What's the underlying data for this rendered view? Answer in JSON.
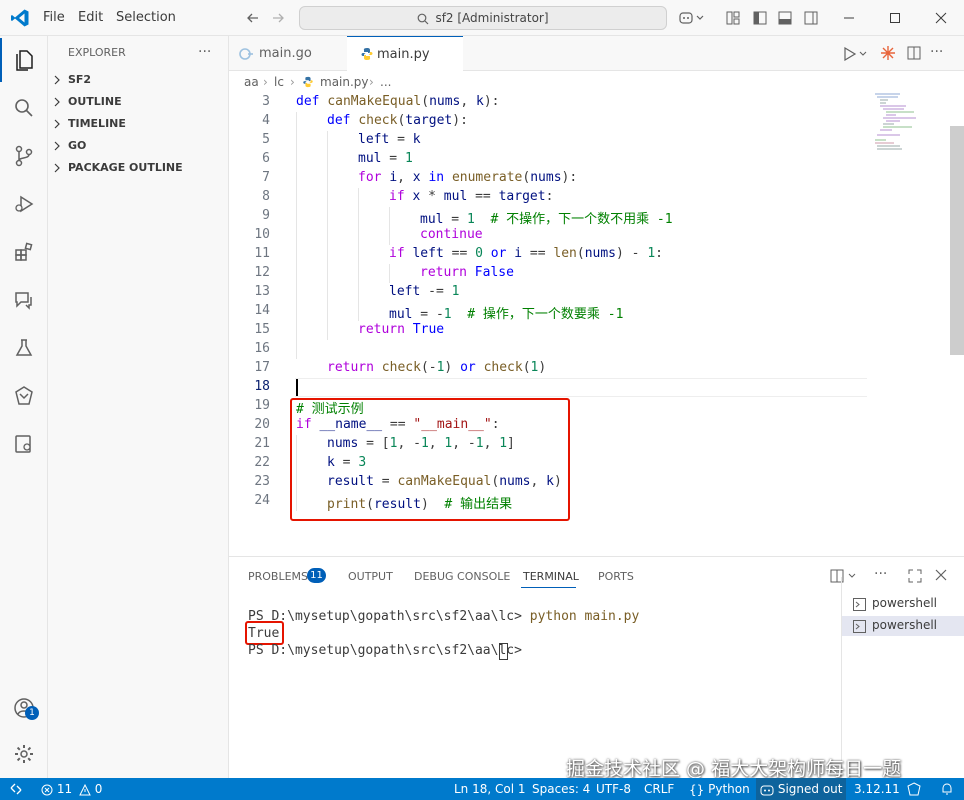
{
  "titlebar": {
    "menu": [
      "File",
      "Edit",
      "Selection"
    ],
    "search_text": "sf2 [Administrator]"
  },
  "sidebar": {
    "title": "EXPLORER",
    "sections": [
      "SF2",
      "OUTLINE",
      "TIMELINE",
      "GO",
      "PACKAGE OUTLINE"
    ]
  },
  "tabs": [
    {
      "label": "main.go",
      "active": false
    },
    {
      "label": "main.py",
      "active": true
    }
  ],
  "breadcrumb": [
    "aa",
    "lc",
    "main.py",
    "..."
  ],
  "editor": {
    "current_line": 18,
    "lines": [
      {
        "n": "3",
        "indent": 0,
        "tokens": [
          {
            "t": "def ",
            "c": "kw"
          },
          {
            "t": "canMakeEqual",
            "c": "fn"
          },
          {
            "t": "("
          },
          {
            "t": "nums",
            "c": "var"
          },
          {
            "t": ", "
          },
          {
            "t": "k",
            "c": "var"
          },
          {
            "t": "):"
          }
        ]
      },
      {
        "n": "4",
        "indent": 1,
        "tokens": [
          {
            "t": "def ",
            "c": "kw"
          },
          {
            "t": "check",
            "c": "fn"
          },
          {
            "t": "("
          },
          {
            "t": "target",
            "c": "var"
          },
          {
            "t": "):"
          }
        ]
      },
      {
        "n": "5",
        "indent": 2,
        "tokens": [
          {
            "t": "left",
            "c": "var"
          },
          {
            "t": " = "
          },
          {
            "t": "k",
            "c": "var"
          }
        ]
      },
      {
        "n": "6",
        "indent": 2,
        "tokens": [
          {
            "t": "mul",
            "c": "var"
          },
          {
            "t": " = "
          },
          {
            "t": "1",
            "c": "num"
          }
        ]
      },
      {
        "n": "7",
        "indent": 2,
        "tokens": [
          {
            "t": "for ",
            "c": "kwc"
          },
          {
            "t": "i",
            "c": "var"
          },
          {
            "t": ", "
          },
          {
            "t": "x",
            "c": "var"
          },
          {
            "t": " in ",
            "c": "kw"
          },
          {
            "t": "enumerate",
            "c": "fn"
          },
          {
            "t": "("
          },
          {
            "t": "nums",
            "c": "var"
          },
          {
            "t": "):"
          }
        ]
      },
      {
        "n": "8",
        "indent": 3,
        "tokens": [
          {
            "t": "if ",
            "c": "kwc"
          },
          {
            "t": "x",
            "c": "var"
          },
          {
            "t": " * "
          },
          {
            "t": "mul",
            "c": "var"
          },
          {
            "t": " == "
          },
          {
            "t": "target",
            "c": "var"
          },
          {
            "t": ":"
          }
        ]
      },
      {
        "n": "9",
        "indent": 4,
        "tokens": [
          {
            "t": "mul",
            "c": "var"
          },
          {
            "t": " = "
          },
          {
            "t": "1",
            "c": "num"
          },
          {
            "t": "  "
          },
          {
            "t": "# 不操作，下一个数不用乘 -1",
            "c": "cmt"
          }
        ]
      },
      {
        "n": "10",
        "indent": 4,
        "tokens": [
          {
            "t": "continue",
            "c": "kwc"
          }
        ]
      },
      {
        "n": "11",
        "indent": 3,
        "tokens": [
          {
            "t": "if ",
            "c": "kwc"
          },
          {
            "t": "left",
            "c": "var"
          },
          {
            "t": " == "
          },
          {
            "t": "0",
            "c": "num"
          },
          {
            "t": " or ",
            "c": "kw"
          },
          {
            "t": "i",
            "c": "var"
          },
          {
            "t": " == "
          },
          {
            "t": "len",
            "c": "fn"
          },
          {
            "t": "("
          },
          {
            "t": "nums",
            "c": "var"
          },
          {
            "t": ") - "
          },
          {
            "t": "1",
            "c": "num"
          },
          {
            "t": ":"
          }
        ]
      },
      {
        "n": "12",
        "indent": 4,
        "tokens": [
          {
            "t": "return ",
            "c": "kwc"
          },
          {
            "t": "False",
            "c": "kw"
          }
        ]
      },
      {
        "n": "13",
        "indent": 3,
        "tokens": [
          {
            "t": "left",
            "c": "var"
          },
          {
            "t": " -= "
          },
          {
            "t": "1",
            "c": "num"
          }
        ]
      },
      {
        "n": "14",
        "indent": 3,
        "tokens": [
          {
            "t": "mul",
            "c": "var"
          },
          {
            "t": " = -"
          },
          {
            "t": "1",
            "c": "num"
          },
          {
            "t": "  "
          },
          {
            "t": "# 操作，下一个数要乘 -1",
            "c": "cmt"
          }
        ]
      },
      {
        "n": "15",
        "indent": 2,
        "tokens": [
          {
            "t": "return ",
            "c": "kwc"
          },
          {
            "t": "True",
            "c": "kw"
          }
        ]
      },
      {
        "n": "16",
        "indent": 0,
        "tokens": []
      },
      {
        "n": "17",
        "indent": 1,
        "tokens": [
          {
            "t": "return ",
            "c": "kwc"
          },
          {
            "t": "check",
            "c": "fn"
          },
          {
            "t": "(-"
          },
          {
            "t": "1",
            "c": "num"
          },
          {
            "t": ") "
          },
          {
            "t": "or",
            "c": "kw"
          },
          {
            "t": " "
          },
          {
            "t": "check",
            "c": "fn"
          },
          {
            "t": "("
          },
          {
            "t": "1",
            "c": "num"
          },
          {
            "t": ")"
          }
        ]
      },
      {
        "n": "18",
        "indent": 0,
        "tokens": []
      },
      {
        "n": "19",
        "indent": 0,
        "tokens": [
          {
            "t": "# 测试示例",
            "c": "cmt"
          }
        ]
      },
      {
        "n": "20",
        "indent": 0,
        "tokens": [
          {
            "t": "if ",
            "c": "kwc"
          },
          {
            "t": "__name__",
            "c": "var"
          },
          {
            "t": " == "
          },
          {
            "t": "\"__main__\"",
            "c": "str"
          },
          {
            "t": ":"
          }
        ]
      },
      {
        "n": "21",
        "indent": 1,
        "tokens": [
          {
            "t": "nums",
            "c": "var"
          },
          {
            "t": " = ["
          },
          {
            "t": "1",
            "c": "num"
          },
          {
            "t": ", -"
          },
          {
            "t": "1",
            "c": "num"
          },
          {
            "t": ", "
          },
          {
            "t": "1",
            "c": "num"
          },
          {
            "t": ", -"
          },
          {
            "t": "1",
            "c": "num"
          },
          {
            "t": ", "
          },
          {
            "t": "1",
            "c": "num"
          },
          {
            "t": "]"
          }
        ]
      },
      {
        "n": "22",
        "indent": 1,
        "tokens": [
          {
            "t": "k",
            "c": "var"
          },
          {
            "t": " = "
          },
          {
            "t": "3",
            "c": "num"
          }
        ]
      },
      {
        "n": "23",
        "indent": 1,
        "tokens": [
          {
            "t": "result",
            "c": "var"
          },
          {
            "t": " = "
          },
          {
            "t": "canMakeEqual",
            "c": "fn"
          },
          {
            "t": "("
          },
          {
            "t": "nums",
            "c": "var"
          },
          {
            "t": ", "
          },
          {
            "t": "k",
            "c": "var"
          },
          {
            "t": ")"
          }
        ]
      },
      {
        "n": "24",
        "indent": 1,
        "tokens": [
          {
            "t": "print",
            "c": "fn"
          },
          {
            "t": "("
          },
          {
            "t": "result",
            "c": "var"
          },
          {
            "t": ")  "
          },
          {
            "t": "# 输出结果",
            "c": "cmt"
          }
        ]
      }
    ]
  },
  "panel": {
    "tabs": [
      {
        "label": "PROBLEMS",
        "badge": "11"
      },
      {
        "label": "OUTPUT"
      },
      {
        "label": "DEBUG CONSOLE"
      },
      {
        "label": "TERMINAL",
        "active": true
      },
      {
        "label": "PORTS"
      }
    ],
    "terminal": {
      "prompt1": "PS D:\\mysetup\\gopath\\src\\sf2\\aa\\lc> ",
      "command": "python main.py",
      "output": "True",
      "prompt2": "PS D:\\mysetup\\gopath\\src\\sf2\\aa\\lc> "
    },
    "shells": [
      "powershell",
      "powershell"
    ]
  },
  "accounts_badge": "1",
  "statusbar": {
    "errors": "11",
    "warnings": "0",
    "position": "Ln 18, Col 1",
    "spaces": "Spaces: 4",
    "encoding": "UTF-8",
    "eol": "CRLF",
    "language": "Python",
    "signed": "Signed out",
    "version": "3.12.11"
  },
  "watermark": "掘金技术社区 @ 福大大架构师每日一题",
  "colors": {
    "accent": "#007acc",
    "highlight_box": "#e51400"
  }
}
